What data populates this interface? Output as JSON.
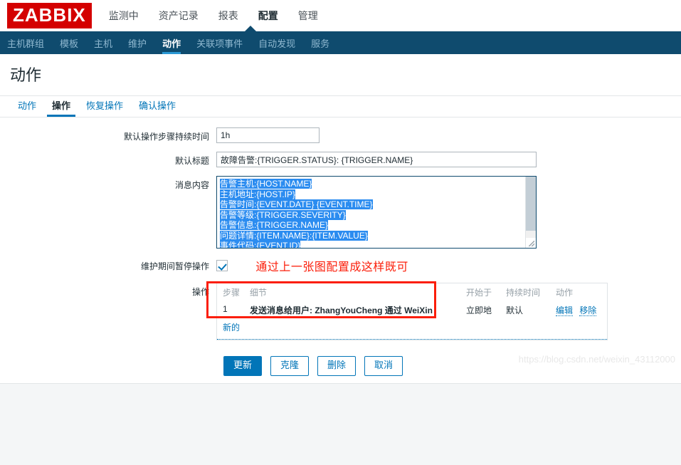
{
  "brand": {
    "logo_text": "ZABBIX",
    "logo_bg": "#d40000",
    "nav_bg": "#0f4b6e",
    "accent": "#0275b8",
    "annotation_color": "#fb1e0a"
  },
  "topmenu": [
    {
      "label": "监测中",
      "active": false
    },
    {
      "label": "资产记录",
      "active": false
    },
    {
      "label": "报表",
      "active": false
    },
    {
      "label": "配置",
      "active": true
    },
    {
      "label": "管理",
      "active": false
    }
  ],
  "navmenu": [
    {
      "label": "主机群组",
      "active": false
    },
    {
      "label": "模板",
      "active": false
    },
    {
      "label": "主机",
      "active": false
    },
    {
      "label": "维护",
      "active": false
    },
    {
      "label": "动作",
      "active": true
    },
    {
      "label": "关联项事件",
      "active": false
    },
    {
      "label": "自动发现",
      "active": false
    },
    {
      "label": "服务",
      "active": false
    }
  ],
  "page": {
    "title": "动作"
  },
  "tabs": [
    {
      "label": "动作",
      "active": false
    },
    {
      "label": "操作",
      "active": true
    },
    {
      "label": "恢复操作",
      "active": false
    },
    {
      "label": "确认操作",
      "active": false
    }
  ],
  "form": {
    "default_duration": {
      "label": "默认操作步骤持续时间",
      "value": "1h",
      "placeholder": "1h"
    },
    "default_subject": {
      "label": "默认标题",
      "value": "故障告警:{TRIGGER.STATUS}: {TRIGGER.NAME}",
      "placeholder": ""
    },
    "message_body": {
      "label": "消息内容",
      "lines": [
        "告警主机:{HOST.NAME}",
        "主机地址:{HOST.IP}",
        "告警时间:{EVENT.DATE} {EVENT.TIME}",
        "告警等级:{TRIGGER.SEVERITY}",
        "告警信息:{TRIGGER.NAME}",
        "问题详情:{ITEM.NAME}:{ITEM.VALUE}",
        "事件代码:{EVENT.ID}"
      ],
      "selection_color": "#2b8cf0"
    },
    "pause_maintenance": {
      "label": "维护期间暂停操作",
      "checked": true
    },
    "annotation": "通过上一张图配置成这样既可",
    "operations": {
      "label": "操作"
    }
  },
  "ops_table": {
    "columns": [
      "步骤",
      "细节",
      "开始于",
      "持续时间",
      "动作"
    ],
    "rows": [
      {
        "step": "1",
        "detail": "发送消息给用户: ZhangYouCheng 通过 WeiXin",
        "start": "立即地",
        "duration": "默认",
        "edit": "编辑",
        "remove": "移除"
      }
    ],
    "new_link": "新的"
  },
  "footer": {
    "update": "更新",
    "clone": "克隆",
    "delete": "删除",
    "cancel": "取消"
  },
  "watermark": "https://blog.csdn.net/weixin_43112000"
}
